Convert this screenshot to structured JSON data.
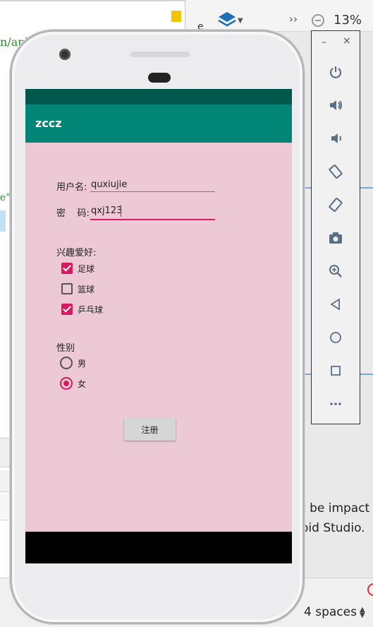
{
  "ide": {
    "code_fragment": "n/apk",
    "code_fragment2": "e\"",
    "side_letter": "e",
    "zoom_level": "13%",
    "right_text_line1": "t be impact",
    "right_text_line2": "oid Studio.",
    "indent_setting": "4 spaces",
    "layers_color": "#1f6fb8"
  },
  "emulator_toolbar": {
    "minimize": "–",
    "close": "×",
    "buttons": [
      "power-icon",
      "volume-up-icon",
      "volume-down-icon",
      "rotate-left-icon",
      "rotate-right-icon",
      "camera-icon",
      "zoom-icon",
      "back-icon",
      "home-icon",
      "overview-icon",
      "more-icon"
    ]
  },
  "app": {
    "title": "zccz",
    "colors": {
      "status_bar": "#00574b",
      "app_bar": "#008577",
      "accent": "#d81b60",
      "background": "#ecc9d5"
    },
    "form": {
      "username_label": "用户名:",
      "username_value": "quxiujie",
      "password_label": "密    码:",
      "password_value": "qxj123",
      "hobbies_label": "兴趣爱好:",
      "hobbies": [
        {
          "label": "足球",
          "checked": true
        },
        {
          "label": "篮球",
          "checked": false
        },
        {
          "label": "乒乓球",
          "checked": true
        }
      ],
      "gender_label": "性别",
      "genders": [
        {
          "label": "男",
          "selected": false
        },
        {
          "label": "女",
          "selected": true
        }
      ],
      "register_button": "注册"
    }
  }
}
